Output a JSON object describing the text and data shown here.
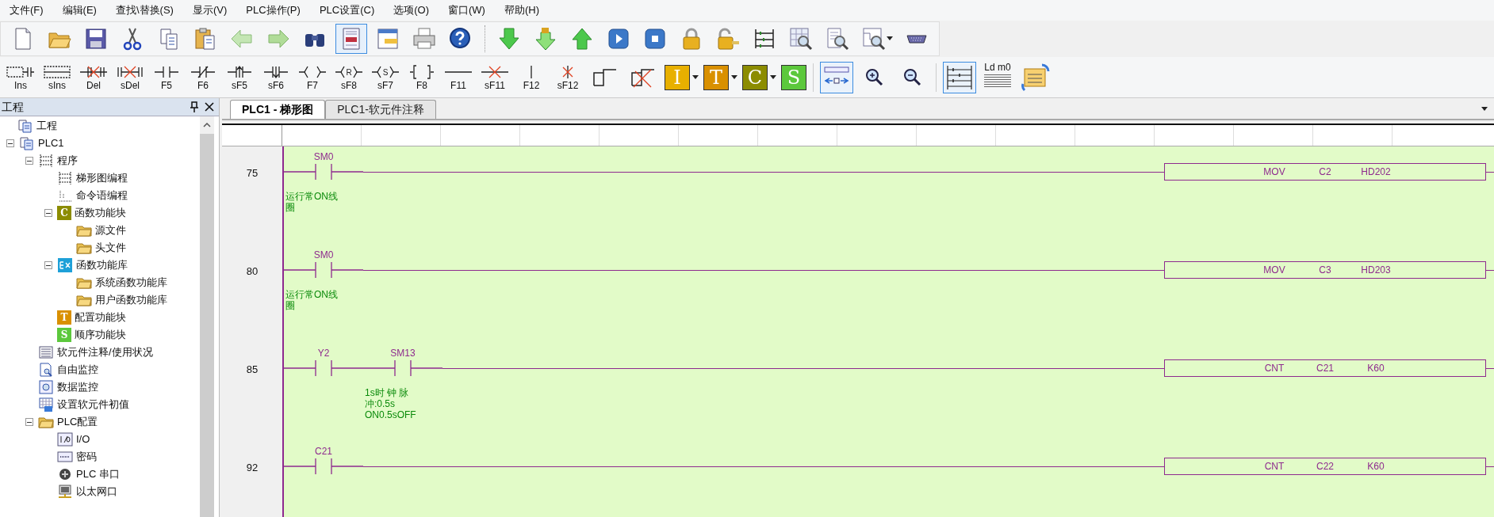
{
  "menu": [
    "文件(F)",
    "编辑(E)",
    "查找\\替换(S)",
    "显示(V)",
    "PLC操作(P)",
    "PLC设置(C)",
    "选项(O)",
    "窗口(W)",
    "帮助(H)"
  ],
  "toolbar_main": [
    {
      "kind": "new"
    },
    {
      "kind": "open"
    },
    {
      "kind": "save"
    },
    {
      "kind": "cut"
    },
    {
      "kind": "copy"
    },
    {
      "kind": "paste"
    },
    {
      "kind": "back"
    },
    {
      "kind": "forward"
    },
    {
      "kind": "find"
    },
    {
      "kind": "view",
      "pressed": true
    },
    {
      "kind": "window"
    },
    {
      "kind": "print"
    },
    {
      "kind": "help"
    },
    {
      "kind": "separator"
    },
    {
      "kind": "download"
    },
    {
      "kind": "download-lock"
    },
    {
      "kind": "upload"
    },
    {
      "kind": "run"
    },
    {
      "kind": "stop"
    },
    {
      "kind": "lock"
    },
    {
      "kind": "unlock"
    },
    {
      "kind": "ladder"
    },
    {
      "kind": "table-search"
    },
    {
      "kind": "doc-search"
    },
    {
      "kind": "ladder-search"
    },
    {
      "kind": "port"
    }
  ],
  "toolbar_ladder": [
    {
      "kind": "ins",
      "label": "Ins"
    },
    {
      "kind": "sins",
      "label": "sIns"
    },
    {
      "kind": "del",
      "label": "Del"
    },
    {
      "kind": "sdel",
      "label": "sDel"
    },
    {
      "kind": "contact",
      "label": "F5"
    },
    {
      "kind": "ncontact",
      "label": "F6"
    },
    {
      "kind": "rise",
      "label": "sF5"
    },
    {
      "kind": "fall",
      "label": "sF6"
    },
    {
      "kind": "coil",
      "label": "F7"
    },
    {
      "kind": "coil",
      "label": "sF8",
      "inner": "R"
    },
    {
      "kind": "coil",
      "label": "sF7",
      "inner": "S"
    },
    {
      "kind": "bracket",
      "label": "F8"
    },
    {
      "kind": "hline",
      "label": "F11"
    },
    {
      "kind": "hdel",
      "label": "sF11"
    },
    {
      "kind": "vline",
      "label": "F12"
    },
    {
      "kind": "vdel",
      "label": "sF12"
    },
    {
      "kind": "step"
    },
    {
      "kind": "stepdel"
    },
    {
      "kind": "letter",
      "text": "I",
      "color": "#e8b000",
      "dropdown": true
    },
    {
      "kind": "letter",
      "text": "T",
      "color": "#d99000",
      "dropdown": true
    },
    {
      "kind": "letter",
      "text": "C",
      "color": "#8c8c00",
      "dropdown": true
    },
    {
      "kind": "letter",
      "text": "S",
      "color": "#5cc83c",
      "dropdown": false
    },
    {
      "kind": "separator"
    },
    {
      "kind": "width",
      "pressed": true
    },
    {
      "kind": "zoom-in"
    },
    {
      "kind": "zoom-out"
    },
    {
      "kind": "separator"
    },
    {
      "kind": "ladder-view",
      "pressed": true
    },
    {
      "kind": "instruction-view",
      "text": "Ld m0"
    },
    {
      "kind": "convert"
    }
  ],
  "sidebar": {
    "title": "工程",
    "tree": [
      {
        "label": "工程",
        "kind": "project",
        "children": [
          {
            "label": "PLC1",
            "kind": "plc",
            "expanded": true,
            "children": [
              {
                "label": "程序",
                "kind": "program",
                "expanded": true,
                "children": [
                  {
                    "label": "梯形图编程",
                    "kind": "ladder"
                  },
                  {
                    "label": "命令语编程",
                    "kind": "ld"
                  },
                  {
                    "label": "函数功能块",
                    "kind": "c-block",
                    "badge": "C",
                    "expanded": true,
                    "children": [
                      {
                        "label": "源文件",
                        "kind": "folder"
                      },
                      {
                        "label": "头文件",
                        "kind": "folder"
                      }
                    ]
                  },
                  {
                    "label": "函数功能库",
                    "kind": "ex",
                    "expanded": true,
                    "children": [
                      {
                        "label": "系统函数功能库",
                        "kind": "folder"
                      },
                      {
                        "label": "用户函数功能库",
                        "kind": "folder"
                      }
                    ]
                  },
                  {
                    "label": "配置功能块",
                    "kind": "t-block",
                    "badge": "T"
                  },
                  {
                    "label": "顺序功能块",
                    "kind": "s-block",
                    "badge": "S"
                  }
                ]
              },
              {
                "label": "软元件注释/使用状况",
                "kind": "list"
              },
              {
                "label": "自由监控",
                "kind": "monitor"
              },
              {
                "label": "数据监控",
                "kind": "data-monitor"
              },
              {
                "label": "设置软元件初值",
                "kind": "init"
              },
              {
                "label": "PLC配置",
                "kind": "folder",
                "expanded": true,
                "children": [
                  {
                    "label": "I/O",
                    "kind": "io"
                  },
                  {
                    "label": "密码",
                    "kind": "password"
                  },
                  {
                    "label": "PLC 串口",
                    "kind": "serial"
                  },
                  {
                    "label": "以太网口",
                    "kind": "ethernet"
                  }
                ]
              }
            ]
          }
        ]
      }
    ]
  },
  "tabs": [
    {
      "label": "PLC1 - 梯形图",
      "selected": true
    },
    {
      "label": "PLC1-软元件注释",
      "selected": false
    }
  ],
  "rungs": [
    {
      "number": "75",
      "contacts": [
        {
          "label": "SM0",
          "comment_lines": [
            "运行常ON线",
            "圈"
          ]
        }
      ],
      "instruction": [
        "MOV",
        "C2",
        "HD202"
      ]
    },
    {
      "number": "80",
      "contacts": [
        {
          "label": "SM0",
          "comment_lines": [
            "运行常ON线",
            "圈"
          ]
        }
      ],
      "instruction": [
        "MOV",
        "C3",
        "HD203"
      ]
    },
    {
      "number": "85",
      "contacts": [
        {
          "label": "Y2"
        },
        {
          "label": "SM13",
          "comment_lines": [
            "1s时 钟 脉",
            "冲:0.5s",
            "ON0.5sOFF"
          ]
        }
      ],
      "instruction": [
        "CNT",
        "C21",
        "K60"
      ]
    },
    {
      "number": "92",
      "contacts": [
        {
          "label": "C21"
        }
      ],
      "instruction": [
        "CNT",
        "C22",
        "K60"
      ]
    }
  ]
}
